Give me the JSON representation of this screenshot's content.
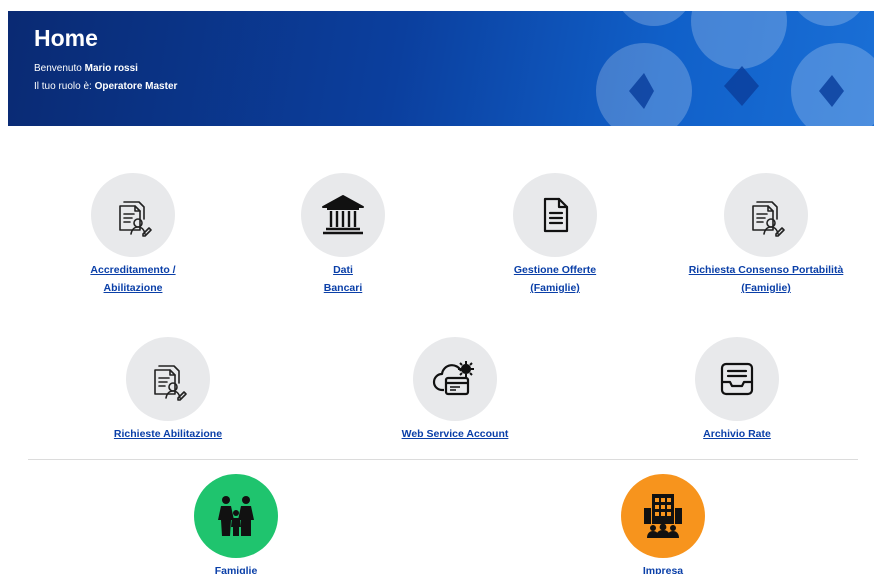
{
  "header": {
    "title": "Home",
    "welcome_prefix": "Benvenuto ",
    "user_name": "Mario rossi",
    "role_prefix": "Il tuo ruolo è: ",
    "role": "Operatore Master"
  },
  "tiles_row1": [
    {
      "line1": "Accreditamento /",
      "line2": "Abilitazione",
      "icon": "document-user-icon"
    },
    {
      "line1": "Dati",
      "line2": "Bancari",
      "icon": "bank-icon"
    },
    {
      "line1": "Gestione Offerte",
      "line2": "(Famiglie)",
      "icon": "document-icon"
    },
    {
      "line1": "Richiesta Consenso Portabilità",
      "line2": "(Famiglie)",
      "icon": "document-user-icon"
    }
  ],
  "tiles_row2": [
    {
      "line1": "Richieste Abilitazione",
      "icon": "document-user-icon"
    },
    {
      "line1": "Web Service Account",
      "icon": "cloud-gear-icon"
    },
    {
      "line1": "Archivio Rate",
      "icon": "inbox-tray-icon"
    }
  ],
  "tiles_row3": [
    {
      "line1": "Famiglie",
      "icon": "family-icon"
    },
    {
      "line1": "Impresa",
      "icon": "building-people-icon"
    }
  ],
  "colors": {
    "banner": "#0b3f9e",
    "link": "#0a3fa8",
    "famiglie": "#1fc46e",
    "impresa": "#f7941d"
  }
}
